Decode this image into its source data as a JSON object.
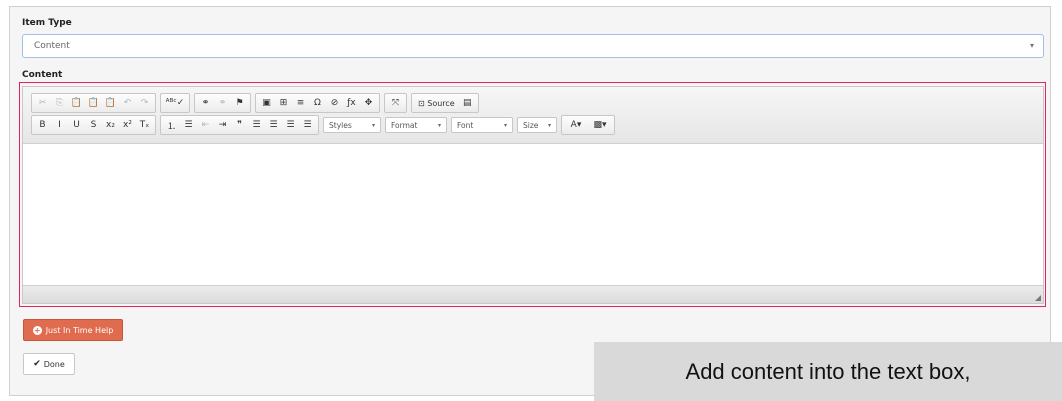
{
  "form": {
    "item_type_label": "Item Type",
    "item_type_value": "Content",
    "content_label": "Content"
  },
  "toolbar": {
    "row1_groups": [
      [
        {
          "icon": "cut-icon",
          "glyph": "✂",
          "dim": true
        },
        {
          "icon": "copy-icon",
          "glyph": "⎘",
          "dim": true
        },
        {
          "icon": "paste-icon",
          "glyph": "📋",
          "dim": false
        },
        {
          "icon": "paste-text-icon",
          "glyph": "📋",
          "dim": false
        },
        {
          "icon": "paste-word-icon",
          "glyph": "📋",
          "dim": false
        },
        {
          "icon": "undo-icon",
          "glyph": "↶",
          "dim": true
        },
        {
          "icon": "redo-icon",
          "glyph": "↷",
          "dim": true
        }
      ],
      [
        {
          "icon": "spellcheck-icon",
          "glyph": "ᴬᴮᶜ✓",
          "dim": false,
          "wide": true
        }
      ],
      [
        {
          "icon": "link-icon",
          "glyph": "⚭",
          "dim": false
        },
        {
          "icon": "unlink-icon",
          "glyph": "⚭",
          "dim": true
        },
        {
          "icon": "anchor-flag-icon",
          "glyph": "⚑",
          "dim": false
        }
      ],
      [
        {
          "icon": "image-icon",
          "glyph": "▣",
          "dim": false
        },
        {
          "icon": "table-icon",
          "glyph": "⊞",
          "dim": false
        },
        {
          "icon": "horizontal-line-icon",
          "glyph": "≡",
          "dim": false
        },
        {
          "icon": "special-char-icon",
          "glyph": "Ω",
          "dim": false
        },
        {
          "icon": "iframe-icon",
          "glyph": "⊘",
          "dim": false
        },
        {
          "icon": "formula-icon",
          "glyph": "ƒx",
          "dim": false
        },
        {
          "icon": "anchor-icon",
          "glyph": "✥",
          "dim": false
        }
      ],
      [
        {
          "icon": "maximize-icon",
          "glyph": "⤧",
          "dim": false
        }
      ]
    ],
    "source_label": "Source",
    "row2_groups": [
      [
        {
          "icon": "bold-icon",
          "glyph": "B",
          "dim": false
        },
        {
          "icon": "italic-icon",
          "glyph": "I",
          "dim": false
        },
        {
          "icon": "underline-icon",
          "glyph": "U",
          "dim": false
        },
        {
          "icon": "strikethrough-icon",
          "glyph": "S",
          "dim": false
        },
        {
          "icon": "subscript-icon",
          "glyph": "x₂",
          "dim": false
        },
        {
          "icon": "superscript-icon",
          "glyph": "x²",
          "dim": false
        },
        {
          "icon": "remove-format-icon",
          "glyph": "Tₓ",
          "dim": false
        }
      ],
      [
        {
          "icon": "numbered-list-icon",
          "glyph": "⒈",
          "dim": false
        },
        {
          "icon": "bulleted-list-icon",
          "glyph": "☰",
          "dim": false
        },
        {
          "icon": "outdent-icon",
          "glyph": "⇤",
          "dim": true
        },
        {
          "icon": "indent-icon",
          "glyph": "⇥",
          "dim": false
        },
        {
          "icon": "blockquote-icon",
          "glyph": "❞",
          "dim": false
        },
        {
          "icon": "align-left-icon",
          "glyph": "☰",
          "dim": false
        },
        {
          "icon": "align-center-icon",
          "glyph": "☰",
          "dim": false
        },
        {
          "icon": "align-right-icon",
          "glyph": "☰",
          "dim": false
        },
        {
          "icon": "align-justify-icon",
          "glyph": "☰",
          "dim": false
        }
      ]
    ],
    "combos": {
      "styles": "Styles",
      "format": "Format",
      "font": "Font",
      "size": "Size"
    },
    "text_color_glyph": "A",
    "bg_color_glyph": "▩"
  },
  "buttons": {
    "help_label": "Just In Time Help",
    "done_label": "Done"
  },
  "callout": {
    "text": "Add content into the text box,"
  },
  "colors": {
    "highlight": "#e0245e",
    "help_button": "#e06c50",
    "focus_border": "#9fc1e8"
  }
}
